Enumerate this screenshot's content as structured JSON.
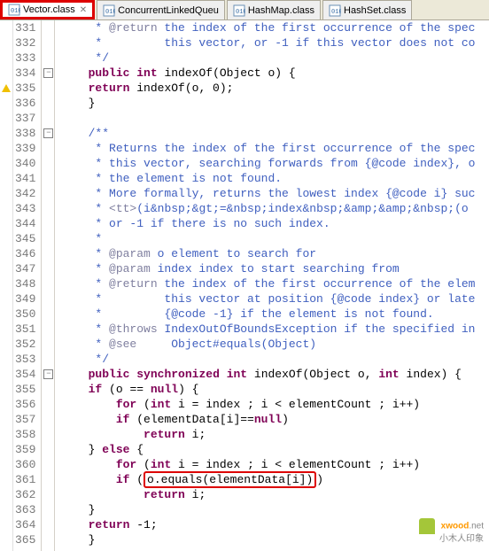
{
  "tabs": [
    {
      "label": "Vector.class",
      "active": true,
      "closeable": true
    },
    {
      "label": "ConcurrentLinkedQueu",
      "active": false,
      "closeable": false
    },
    {
      "label": "HashMap.class",
      "active": false,
      "closeable": false
    },
    {
      "label": "HashSet.class",
      "active": false,
      "closeable": false
    }
  ],
  "line_start": 331,
  "lines": [
    {
      "n": 331,
      "seg": [
        {
          "c": "cm",
          "t": "     * "
        },
        {
          "c": "tag",
          "t": "@return"
        },
        {
          "c": "cm",
          "t": " the index of the first occurrence of the spec"
        }
      ]
    },
    {
      "n": 332,
      "seg": [
        {
          "c": "cm",
          "t": "     *         this vector, or -1 if this vector does not co"
        }
      ]
    },
    {
      "n": 333,
      "seg": [
        {
          "c": "cm",
          "t": "     */"
        }
      ]
    },
    {
      "n": 334,
      "marker": "warn",
      "fold": "minus",
      "seg": [
        {
          "c": "txt",
          "t": "    "
        },
        {
          "c": "kw",
          "t": "public"
        },
        {
          "c": "txt",
          "t": " "
        },
        {
          "c": "kw",
          "t": "int"
        },
        {
          "c": "txt",
          "t": " indexOf(Object o) {"
        }
      ]
    },
    {
      "n": 335,
      "seg": [
        {
          "c": "txt",
          "t": "    "
        },
        {
          "c": "kw",
          "t": "return"
        },
        {
          "c": "txt",
          "t": " indexOf(o, 0);"
        }
      ]
    },
    {
      "n": 336,
      "seg": [
        {
          "c": "txt",
          "t": "    }"
        }
      ]
    },
    {
      "n": 337,
      "seg": [
        {
          "c": "txt",
          "t": ""
        }
      ]
    },
    {
      "n": 338,
      "fold": "minus",
      "seg": [
        {
          "c": "cm",
          "t": "    /**"
        }
      ]
    },
    {
      "n": 339,
      "seg": [
        {
          "c": "cm",
          "t": "     * Returns the index of the first occurrence of the spec"
        }
      ]
    },
    {
      "n": 340,
      "seg": [
        {
          "c": "cm",
          "t": "     * this vector, searching forwards from {@code index}, o"
        }
      ]
    },
    {
      "n": 341,
      "seg": [
        {
          "c": "cm",
          "t": "     * the element is not found."
        }
      ]
    },
    {
      "n": 342,
      "seg": [
        {
          "c": "cm",
          "t": "     * More formally, returns the lowest index {@code i} suc"
        }
      ]
    },
    {
      "n": 343,
      "seg": [
        {
          "c": "cm",
          "t": "     * "
        },
        {
          "c": "tag",
          "t": "<tt>"
        },
        {
          "c": "cm",
          "t": "(i&nbsp;&gt;=&nbsp;index&nbsp;&amp;&amp;&nbsp;(o"
        }
      ]
    },
    {
      "n": 344,
      "seg": [
        {
          "c": "cm",
          "t": "     * or -1 if there is no such index."
        }
      ]
    },
    {
      "n": 345,
      "seg": [
        {
          "c": "cm",
          "t": "     *"
        }
      ]
    },
    {
      "n": 346,
      "seg": [
        {
          "c": "cm",
          "t": "     * "
        },
        {
          "c": "tag",
          "t": "@param"
        },
        {
          "c": "cm",
          "t": " o element to search for"
        }
      ]
    },
    {
      "n": 347,
      "seg": [
        {
          "c": "cm",
          "t": "     * "
        },
        {
          "c": "tag",
          "t": "@param"
        },
        {
          "c": "cm",
          "t": " index index to start searching from"
        }
      ]
    },
    {
      "n": 348,
      "seg": [
        {
          "c": "cm",
          "t": "     * "
        },
        {
          "c": "tag",
          "t": "@return"
        },
        {
          "c": "cm",
          "t": " the index of the first occurrence of the elem"
        }
      ]
    },
    {
      "n": 349,
      "seg": [
        {
          "c": "cm",
          "t": "     *         this vector at position {@code index} or late"
        }
      ]
    },
    {
      "n": 350,
      "seg": [
        {
          "c": "cm",
          "t": "     *         {@code -1} if the element is not found."
        }
      ]
    },
    {
      "n": 351,
      "seg": [
        {
          "c": "cm",
          "t": "     * "
        },
        {
          "c": "tag",
          "t": "@throws"
        },
        {
          "c": "cm",
          "t": " IndexOutOfBoundsException if the specified in"
        }
      ]
    },
    {
      "n": 352,
      "seg": [
        {
          "c": "cm",
          "t": "     * "
        },
        {
          "c": "tag",
          "t": "@see"
        },
        {
          "c": "cm",
          "t": "     Object#equals(Object)"
        }
      ]
    },
    {
      "n": 353,
      "seg": [
        {
          "c": "cm",
          "t": "     */"
        }
      ]
    },
    {
      "n": 354,
      "fold": "minus",
      "seg": [
        {
          "c": "txt",
          "t": "    "
        },
        {
          "c": "kw",
          "t": "public"
        },
        {
          "c": "txt",
          "t": " "
        },
        {
          "c": "kw",
          "t": "synchronized"
        },
        {
          "c": "txt",
          "t": " "
        },
        {
          "c": "kw",
          "t": "int"
        },
        {
          "c": "txt",
          "t": " indexOf(Object o, "
        },
        {
          "c": "kw",
          "t": "int"
        },
        {
          "c": "txt",
          "t": " index) {"
        }
      ]
    },
    {
      "n": 355,
      "seg": [
        {
          "c": "txt",
          "t": "    "
        },
        {
          "c": "kw",
          "t": "if"
        },
        {
          "c": "txt",
          "t": " (o == "
        },
        {
          "c": "kw",
          "t": "null"
        },
        {
          "c": "txt",
          "t": ") {"
        }
      ]
    },
    {
      "n": 356,
      "seg": [
        {
          "c": "txt",
          "t": "        "
        },
        {
          "c": "kw",
          "t": "for"
        },
        {
          "c": "txt",
          "t": " ("
        },
        {
          "c": "kw",
          "t": "int"
        },
        {
          "c": "txt",
          "t": " i = index ; i < elementCount ; i++)"
        }
      ]
    },
    {
      "n": 357,
      "seg": [
        {
          "c": "txt",
          "t": "        "
        },
        {
          "c": "kw",
          "t": "if"
        },
        {
          "c": "txt",
          "t": " (elementData[i]=="
        },
        {
          "c": "kw",
          "t": "null"
        },
        {
          "c": "txt",
          "t": ")"
        }
      ]
    },
    {
      "n": 358,
      "seg": [
        {
          "c": "txt",
          "t": "            "
        },
        {
          "c": "kw",
          "t": "return"
        },
        {
          "c": "txt",
          "t": " i;"
        }
      ]
    },
    {
      "n": 359,
      "seg": [
        {
          "c": "txt",
          "t": "    } "
        },
        {
          "c": "kw",
          "t": "else"
        },
        {
          "c": "txt",
          "t": " {"
        }
      ]
    },
    {
      "n": 360,
      "seg": [
        {
          "c": "txt",
          "t": "        "
        },
        {
          "c": "kw",
          "t": "for"
        },
        {
          "c": "txt",
          "t": " ("
        },
        {
          "c": "kw",
          "t": "int"
        },
        {
          "c": "txt",
          "t": " i = index ; i < elementCount ; i++)"
        }
      ]
    },
    {
      "n": 361,
      "seg": [
        {
          "c": "txt",
          "t": "        "
        },
        {
          "c": "kw",
          "t": "if"
        },
        {
          "c": "txt",
          "t": " ("
        },
        {
          "c": "txt hl",
          "t": "o.equals(elementData[i])"
        },
        {
          "c": "txt",
          "t": ")"
        }
      ]
    },
    {
      "n": 362,
      "seg": [
        {
          "c": "txt",
          "t": "            "
        },
        {
          "c": "kw",
          "t": "return"
        },
        {
          "c": "txt",
          "t": " i;"
        }
      ]
    },
    {
      "n": 363,
      "seg": [
        {
          "c": "txt",
          "t": "    }"
        }
      ]
    },
    {
      "n": 364,
      "seg": [
        {
          "c": "txt",
          "t": "    "
        },
        {
          "c": "kw",
          "t": "return"
        },
        {
          "c": "txt",
          "t": " -1;"
        }
      ]
    },
    {
      "n": 365,
      "seg": [
        {
          "c": "txt",
          "t": "    }"
        }
      ]
    }
  ],
  "watermark": {
    "brand": "xwood",
    "tld": ".net",
    "sub": "小木人印象"
  }
}
